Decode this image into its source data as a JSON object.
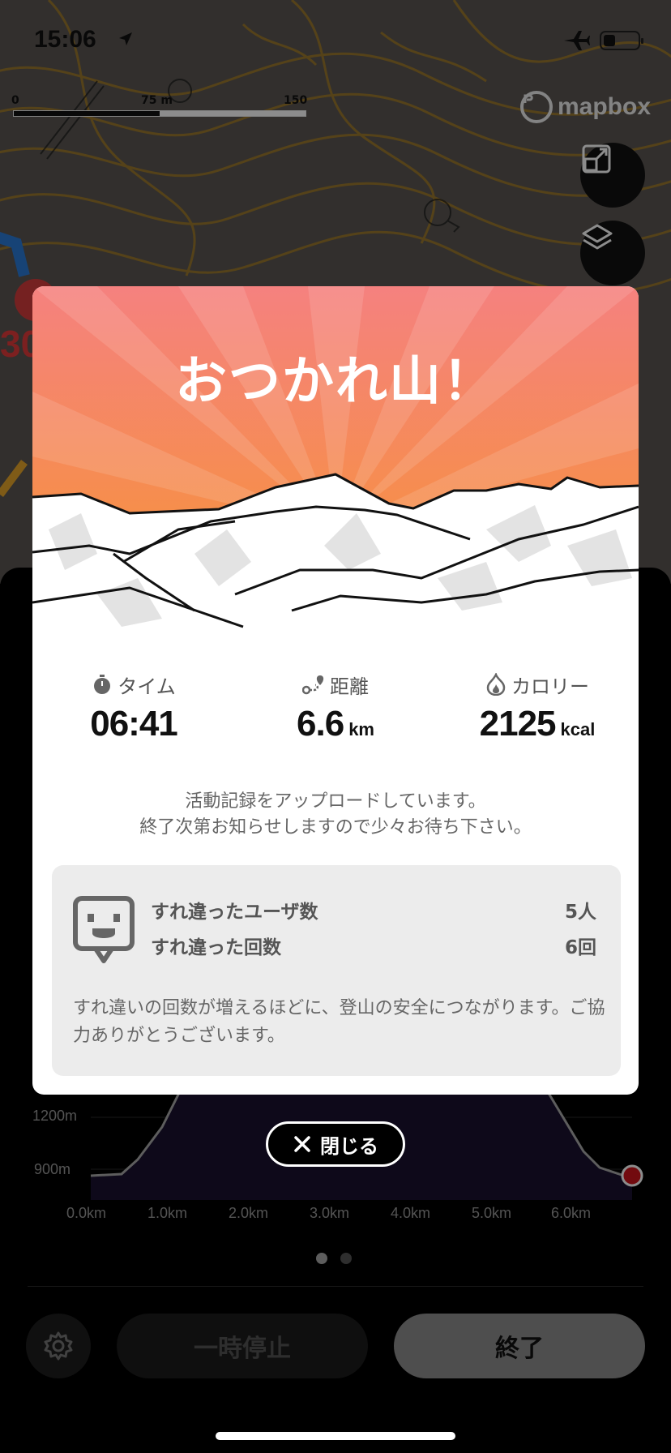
{
  "status_bar": {
    "time": "15:06"
  },
  "map": {
    "scale_labels": [
      "0",
      "75 m",
      "150 m"
    ],
    "attribution": "mapbox"
  },
  "modal": {
    "title": "おつかれ山！",
    "stats": [
      {
        "icon": "stopwatch-icon",
        "label": "タイム",
        "value": "06:41",
        "unit": ""
      },
      {
        "icon": "route-icon",
        "label": "距離",
        "value": "6.6",
        "unit": "km"
      },
      {
        "icon": "flame-icon",
        "label": "カロリー",
        "value": "2125",
        "unit": "kcal"
      }
    ],
    "upload_message_line1": "活動記録をアップロードしています。",
    "upload_message_line2": "終了次第お知らせしますので少々お待ち下さい。",
    "passing": {
      "users_label": "すれ違ったユーザ数",
      "users_value": "5人",
      "count_label": "すれ違った回数",
      "count_value": "6回",
      "note": "すれ違いの回数が増えるほどに、登山の安全につながります。ご協力ありがとうございます。"
    }
  },
  "close_button": {
    "label": "閉じる"
  },
  "elevation_chart": {
    "y_ticks": [
      "1200m",
      "900m"
    ],
    "x_ticks": [
      "0.0km",
      "1.0km",
      "2.0km",
      "3.0km",
      "4.0km",
      "5.0km",
      "6.0km"
    ]
  },
  "controls": {
    "pause_label": "一時停止",
    "end_label": "終了"
  },
  "colors": {
    "hero_top": "#f58a86",
    "hero_bottom": "#f5902f",
    "end_button": "#8e8e8e",
    "track_marker": "#d0151c"
  }
}
